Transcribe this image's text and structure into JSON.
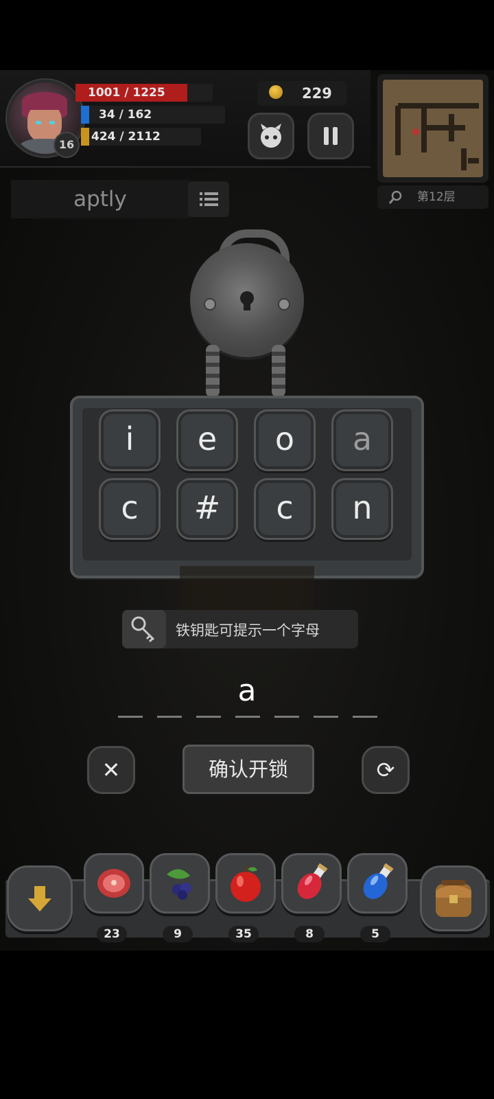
{
  "hud": {
    "level": "16",
    "hp": "1001 / 1225",
    "hp_fraction": 0.817,
    "mp": "34 / 162",
    "mp_fraction": 0.21,
    "xp": "424 / 2112",
    "xp_fraction": 0.2,
    "coins": "229"
  },
  "minimap": {
    "floor_label": "第12层"
  },
  "word": "aptly",
  "keypad": {
    "row1": [
      "i",
      "e",
      "o",
      "a"
    ],
    "row2": [
      "c",
      "#",
      "c",
      "n"
    ]
  },
  "hint": {
    "text": "铁钥匙可提示一个字母"
  },
  "answer": {
    "letter": "a",
    "slots": 7
  },
  "actions": {
    "confirm_label": "确认开锁"
  },
  "inventory": {
    "counts": [
      "23",
      "9",
      "35",
      "8",
      "5"
    ]
  }
}
